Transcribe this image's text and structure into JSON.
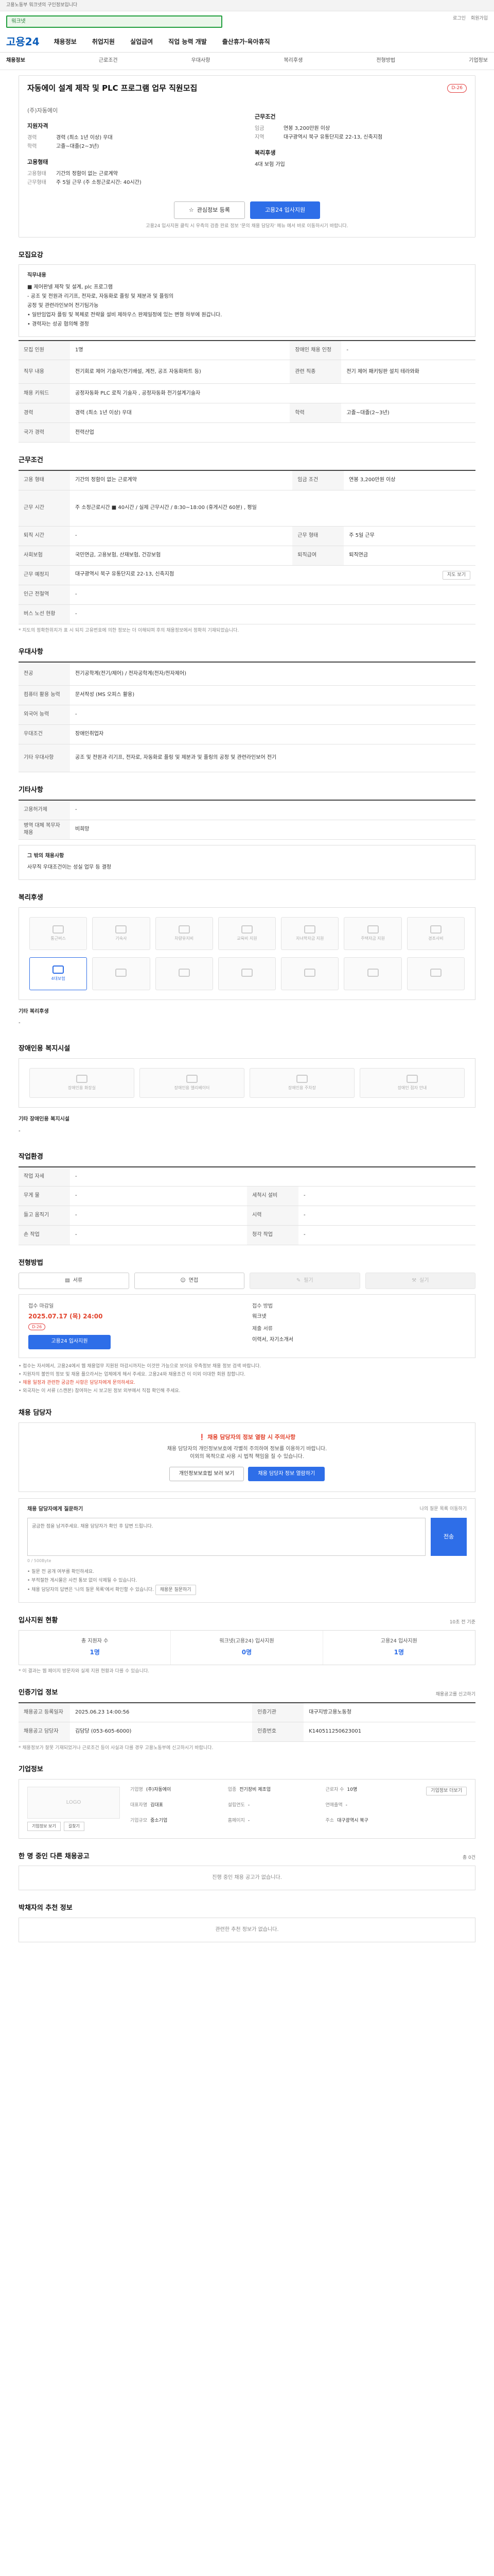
{
  "topbar": {
    "text": "고용노동부 워크넷의 구인정보입니다"
  },
  "search": {
    "value": "워크넷"
  },
  "util": {
    "login": "로그인",
    "join": "회원가입"
  },
  "header": {
    "logo": "고용24",
    "gnb": [
      "채용정보",
      "취업지원",
      "실업급여",
      "직업 능력 개발",
      "출산휴가·육아휴직"
    ]
  },
  "subnav": [
    "채용정보",
    "근로조건",
    "우대사항",
    "복리후생",
    "전형방법",
    "기업정보"
  ],
  "job": {
    "title": "자동에이 설계 제작 및 PLC 프로그램 업무 직원모집",
    "dday": "D-26",
    "company": "(주)자동에이",
    "summary": {
      "qual_head": "지원자격",
      "qual": [
        {
          "k": "경력",
          "v": "경력 (최소 1년 이상) 우대"
        },
        {
          "k": "학력",
          "v": "고졸~대졸(2~3년)"
        }
      ],
      "cond_head": "근무조건",
      "cond": [
        {
          "k": "임금",
          "v": "연봉 3,200만원 이상"
        },
        {
          "k": "지역",
          "v": "대구광역시 북구 유통단지로 22-13, 신축지점"
        }
      ],
      "type_head": "고용형태",
      "type": [
        {
          "k": "고용형태",
          "v": "기간의 정함이 없는 근로계약"
        },
        {
          "k": "근무형태",
          "v": "주 5일 근무 (주 소정근로시간: 40시간)"
        }
      ],
      "wel_head": "복리후생",
      "wel": "4대 보험 가입"
    }
  },
  "actions": {
    "save": "관심정보 등록",
    "apply": "고용24 입사지원"
  },
  "apply_note": "고용24 입사지원 클릭 시 우측의 검증 완료 정보 '문의 채용 담당자' 메뉴 에서 바로 이동하시기 바랍니다.",
  "sec_recruit": {
    "title": "모집요강",
    "box_head": "직무내용",
    "box_lines": [
      "■ 제어판넬 제작 및 설계, plc 프로그램",
      "- 공조 및 전원과 리기프, 전자로, 자동화로 플링 및 제분과 및 플링의",
      "  공정 및 관련라인보어 전기팀가능",
      "• 일반임업자 플링 및 복체로 전략을 설비 제하우스 완제일정에 있는 변형 하부에 원갑니다.",
      "• 경력자는 성공 협의해 결정"
    ],
    "rows": [
      {
        "k1": "모집 인원",
        "v1": "1명",
        "k2": "장애인 채용 인정",
        "v2": "-"
      },
      {
        "k1": "직무 내용",
        "v1": "전기회로 제어 기술자(전기배설, 계전, 공조 자동화파트 등)",
        "k2": "관련 직종",
        "v2": "전기 제어 패키팅판 설치 테라와화"
      },
      {
        "k1": "채용 키워드",
        "v1": "공정자동화 PLC 로직 기술자 , 공정자동화 전기설계기술자",
        "k2": "",
        "v2": ""
      },
      {
        "k1": "경력",
        "v1": "경력 (최소 1년 이상) 우대",
        "k2": "학력",
        "v2": "고졸~대졸(2~3년)"
      },
      {
        "k1": "국가 경력",
        "v1": "전력산업",
        "k2": "",
        "v2": ""
      }
    ]
  },
  "sec_cond": {
    "title": "근무조건",
    "rows": [
      {
        "k1": "고용 형태",
        "v1": "기간의 정함이 없는 근로계약",
        "k2": "임금 조건",
        "v2": "연봉 3,200만원 이상"
      },
      {
        "k1": "근무 시간",
        "v1": "주 소정근로시간 ■ 40시간 / 실제 근무시간 / 8:30~18:00 (휴게시간 60분) , 평일",
        "k2": "",
        "v2": ""
      },
      {
        "k1": "퇴직 시간",
        "v1": "-",
        "k2": "근무 형태",
        "v2": "주 5일 근무"
      },
      {
        "k1": "사회보험",
        "v1": "국민연금, 고용보험, 산재보험, 건강보험",
        "k2": "퇴직급여",
        "v2": "퇴직연금"
      },
      {
        "k1": "근무 예정지",
        "v1": "대구광역시 북구 유통단지로 22-13, 신축지점",
        "k2": "",
        "v2": ""
      },
      {
        "k1": "인근 전철역",
        "v1": "-",
        "k2": "",
        "v2": ""
      },
      {
        "k1": "버스 노선 현황",
        "v1": "-",
        "k2": "",
        "v2": ""
      }
    ],
    "map_btn": "지도 보기",
    "footnote": "* 지도의 정확한위치가 표 시 되지 고유번호에 의한 정보는 더 이해되며 후의 채용정보에서 정확히 기재되었습니다."
  },
  "sec_pref": {
    "title": "우대사항",
    "rows": [
      {
        "k": "전공",
        "v": "전기공학계(전기/제어) / 전자공학계(전자/전자제어)"
      },
      {
        "k": "컴퓨터 활용 능력",
        "v": "문서작성 (MS 오피스 활용)"
      },
      {
        "k": "외국어 능력",
        "v": "-"
      },
      {
        "k": "우대조건",
        "v": "장애인취업자"
      },
      {
        "k": "기타 우대사항",
        "v": "공조 및 전원과 리기프, 전자로, 자동화로 플링 및 제분과 및 플링의 공정 및 관련라인보어 전기"
      }
    ]
  },
  "sec_etc": {
    "title": "기타사항",
    "rows": [
      {
        "k": "고용허가제",
        "v": "-"
      },
      {
        "k": "병역 대체 복무자 채용",
        "v": "비희망"
      }
    ],
    "box_head": "그 밖의 채용사항",
    "box_line": "사무직 우대조건이는 성실 업무 등 결정"
  },
  "sec_welfare": {
    "title": "복리후생",
    "items": [
      "통근버스",
      "기숙사",
      "차량유지비",
      "교육비 지원",
      "자녀학자금 지원",
      "주택자금 지원",
      "경조사비",
      "4대보험",
      "",
      "",
      "",
      "",
      "",
      ""
    ],
    "on_index": 7,
    "etc_label": "기타 복리후생",
    "etc_value": "-"
  },
  "sec_disabled": {
    "title": "장애인용 복지시설",
    "items": [
      "장애인용 화장실",
      "장애인용 엘리베이터",
      "장애인용 주차장",
      "장애인 점자 안내"
    ],
    "etc_label": "기타 장애인용 복지시설",
    "etc_value": "-"
  },
  "sec_env": {
    "title": "작업환경",
    "rows": [
      {
        "k1": "작업 자세",
        "v1": "-",
        "k2": "",
        "v2": ""
      },
      {
        "k1": "무게 물",
        "v1": "-",
        "k2": "세척시 설비",
        "v2": "-"
      },
      {
        "k1": "들고 움직기",
        "v1": "-",
        "k2": "시력",
        "v2": "-"
      },
      {
        "k1": "손 작업",
        "v1": "-",
        "k2": "청각 작업",
        "v2": "-"
      }
    ]
  },
  "sec_select": {
    "title": "전형방법",
    "tabs": [
      "서류",
      "면접",
      "필기",
      "실기"
    ],
    "deadline_label": "접수 마감일",
    "deadline": "2025.07.17 (목) 24:00",
    "deadline_badge": "D-26",
    "apply_btn": "고용24 입사지원",
    "method_label": "접수 방법",
    "method": "워크넷",
    "docs_label": "제출 서류",
    "docs": "이력서, 자기소개서",
    "notes": [
      "접수는 자서에서, 고용24에서 웹 채용업무 지원된 마감시까지는 이것만 가능으로 보이요 우측정보 채용 정보 검색 바랍니다.",
      "지원자의 불만의 정보 및 채용 플으라서는 업체에게 해서 주세요. 고용24와 채용조건 이 이외 이대한 회원 참합니다.",
      "채용 일정과 관련한 궁금한 사항은 담당자에게 문의하세요.",
      "외국자는 이 서류 (스캔본) 참여하는 시 보고된 정보 외부에서 직접 확인해 주세요."
    ]
  },
  "sec_contact": {
    "title": "채용 담당자",
    "warn_title": "채용 담당자의 정보 열람 시 주의사항",
    "warn_lines": [
      "채용 담당자의 개인정보보호에 각별히 주의하여 정보를 이용하기 바랍니다.",
      "이외의 목적으로 사용 시 법적 책임을 질 수 있습니다."
    ],
    "warn_btn1": "개인정보보호법 보러 보기",
    "warn_btn2": "채용 담당자 정보 열람하기",
    "inq_title": "채용 담당자에게 질문하기",
    "inq_right": "나의 질문 목록 이동하기",
    "inq_placeholder": "궁금한 점을 남겨주세요. 채용 담당자가 확인 후 답변 드립니다.",
    "inq_send": "전송",
    "inq_count": "0 / 500Byte",
    "inq_notes": [
      "질문 전 공개 여부를 확인하세요.",
      "부적절한 게시물은 사전 통보 없이 삭제될 수 있습니다.",
      "채용 담당자의 답변은 '나의 질문 목록'에서 확인할 수 있습니다."
    ],
    "inq_tag": "채용문 질문하기"
  },
  "sec_stats": {
    "title": "입사지원 현황",
    "right": "10초 전 기준",
    "items": [
      {
        "l": "총 지원자 수",
        "n": "1명"
      },
      {
        "l": "워크넷(고용24) 입사지원",
        "n": "0명"
      },
      {
        "l": "고용24 입사지원",
        "n": "1명"
      }
    ],
    "note": "* 이 결과는 웹 페이지 방문자와 실제 지원 현황과 다를 수 있습니다."
  },
  "sec_notice": {
    "title": "인증기업 정보",
    "right": "채용공고를 신고하기",
    "rows": [
      {
        "k1": "채용공고 등록일자",
        "v1": "2025.06.23 14:00:56",
        "k2": "인증기관",
        "v2": "대구지방고용노동청"
      },
      {
        "k1": "채용공고 담당자",
        "v1": "김담당 (053-605-6000)",
        "k2": "인증번호",
        "v2": "K140511250623001"
      }
    ],
    "footnote": "* 채용정보가 잘못 기재되었거나 근로조건 등이 사실과 다를 경우 고용노동부에 신고하시기 바랍니다."
  },
  "sec_company": {
    "title": "기업정보",
    "logo": "LOGO",
    "btns": [
      "기업정보 보기",
      "길찾기"
    ],
    "info": [
      {
        "k": "기업명",
        "v": "(주)자동에이"
      },
      {
        "k": "업종",
        "v": "전기장비 제조업"
      },
      {
        "k": "근로자 수",
        "v": "10명"
      },
      {
        "k": "대표자명",
        "v": "김대표"
      },
      {
        "k": "설립연도",
        "v": "-"
      },
      {
        "k": "연매출액",
        "v": "-"
      },
      {
        "k": "기업규모",
        "v": "중소기업"
      },
      {
        "k": "홈페이지",
        "v": "-"
      },
      {
        "k": "주소",
        "v": "대구광역시 북구"
      }
    ],
    "side_btn": "기업정보 더보기"
  },
  "sec_other": {
    "title": "한 명 중인 다른 채용공고",
    "right": "총 0건",
    "empty": "진행 중인 채용 공고가 없습니다."
  },
  "sec_recommend": {
    "title": "박채자의 추천 정보",
    "empty": "관련한 추천 정보가 없습니다."
  }
}
